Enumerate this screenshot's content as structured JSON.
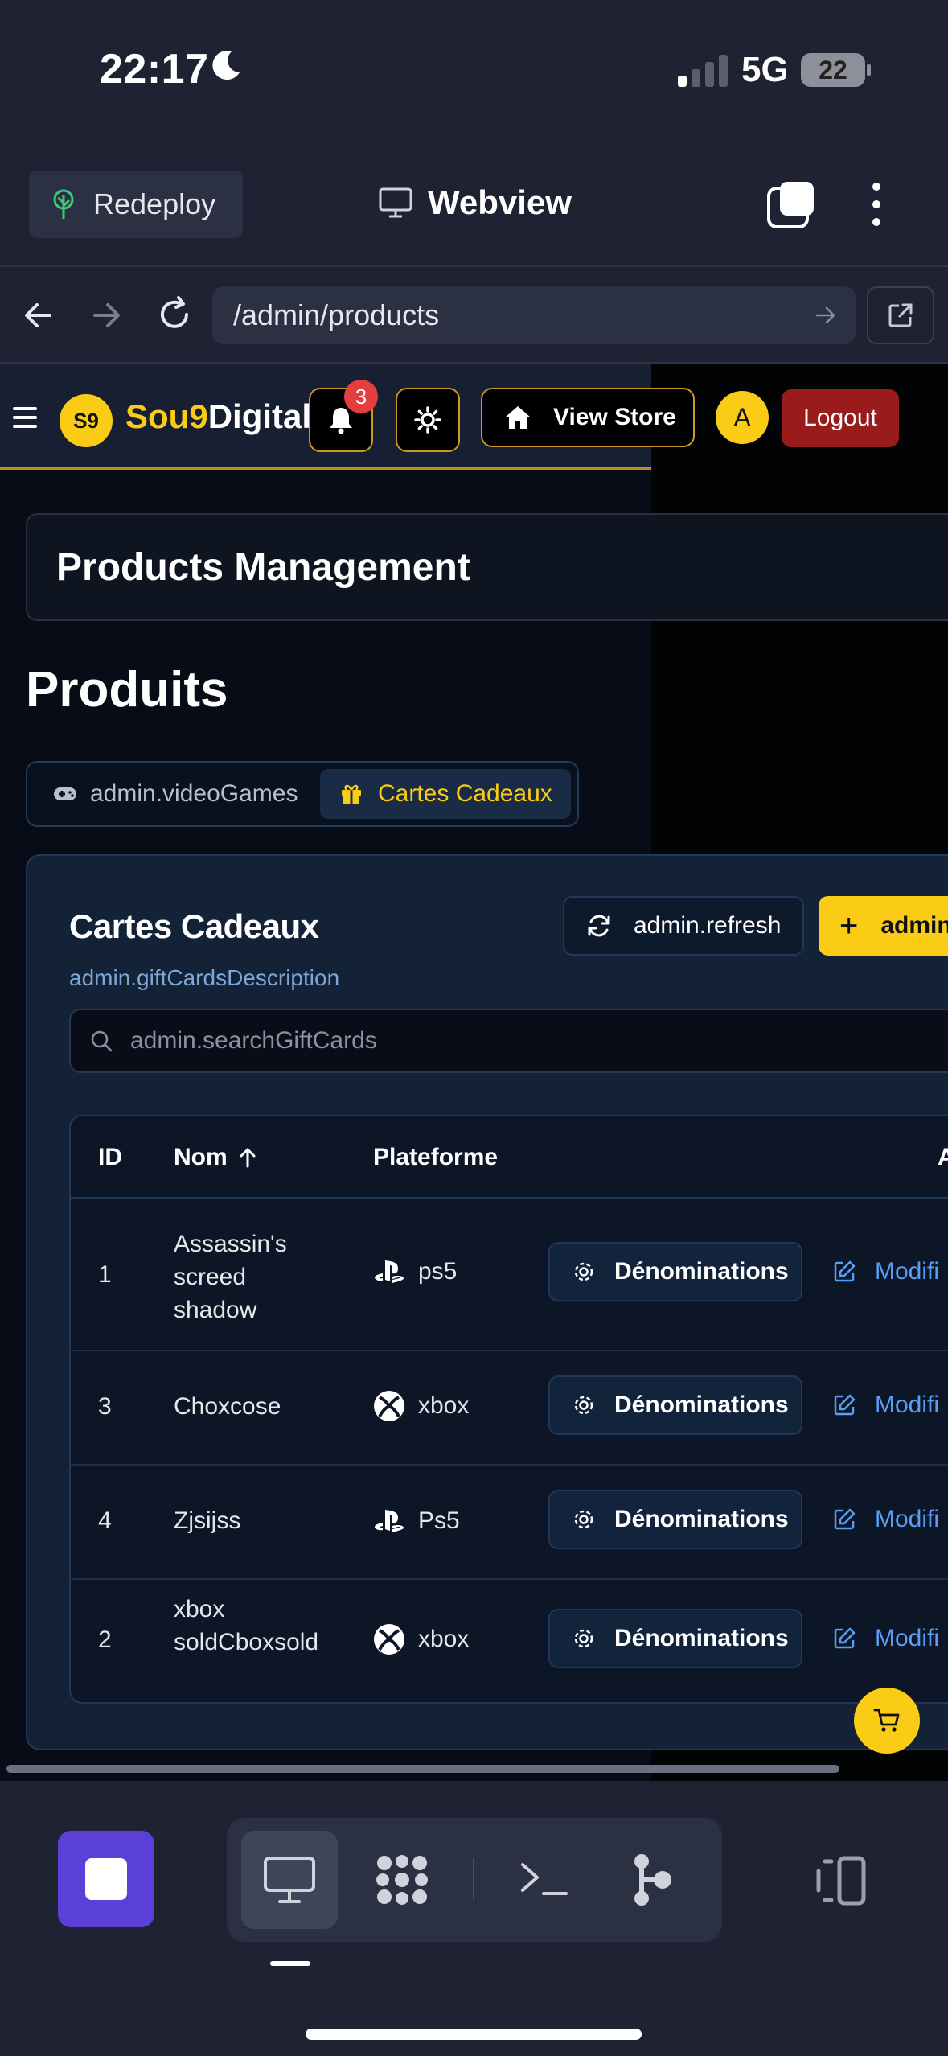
{
  "status_bar": {
    "time": "22:17",
    "network": "5G",
    "battery": "22"
  },
  "app_toolbar": {
    "redeploy_label": "Redeploy",
    "title": "Webview"
  },
  "url_bar": {
    "url": "/admin/products"
  },
  "site_header": {
    "logo_badge": "S9",
    "brand_highlight": "Sou9",
    "brand_rest": "Digital",
    "notification_count": "3",
    "view_store_label": "View Store",
    "avatar_initial": "A",
    "logout_label": "Logout"
  },
  "page": {
    "card_title": "Products Management",
    "heading": "Produits",
    "tabs": [
      {
        "label": "admin.videoGames",
        "icon": "gamepad-icon",
        "active": false
      },
      {
        "label": "Cartes Cadeaux",
        "icon": "gift-icon",
        "active": true
      }
    ]
  },
  "gift_cards": {
    "title": "Cartes Cadeaux",
    "description": "admin.giftCardsDescription",
    "refresh_label": "admin.refresh",
    "add_label": "admin",
    "search_placeholder": "admin.searchGiftCards",
    "table": {
      "headers": {
        "id": "ID",
        "name": "Nom",
        "platform": "Plateforme",
        "actions": "Act"
      },
      "rows": [
        {
          "id": "1",
          "name": "Assassin's screed shadow",
          "platform": "ps5",
          "platform_icon": "playstation-icon",
          "denominations": "Dénominations",
          "edit": "Modifi"
        },
        {
          "id": "3",
          "name": "Choxcose",
          "platform": "xbox",
          "platform_icon": "xbox-icon",
          "denominations": "Dénominations",
          "edit": "Modifi"
        },
        {
          "id": "4",
          "name": "Zjsijss",
          "platform": "Ps5",
          "platform_icon": "playstation-icon",
          "denominations": "Dénominations",
          "edit": "Modifi"
        },
        {
          "id": "2",
          "name": "xbox soldCboxsold",
          "platform": "xbox",
          "platform_icon": "xbox-icon",
          "denominations": "Dénominations",
          "edit": "Modifi"
        }
      ]
    }
  },
  "colors": {
    "accent": "#facc15",
    "logout": "#991b1b",
    "link": "#5b9cf5",
    "stop": "#5b3fd9"
  }
}
